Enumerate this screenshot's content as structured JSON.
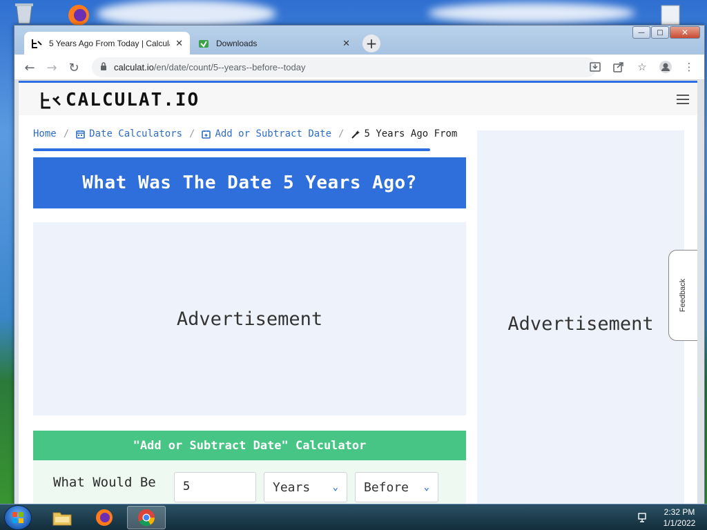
{
  "browser": {
    "tabs": [
      {
        "title": "5 Years Ago From Today | Calcula",
        "active": true
      },
      {
        "title": "Downloads",
        "active": false
      }
    ],
    "new_tab_label": "+",
    "address": {
      "host": "calculat.io",
      "path": "/en/date/count/5--years--before--today"
    }
  },
  "site": {
    "logo_text": "CALCULAT.IO",
    "breadcrumb": [
      {
        "label": "Home",
        "icon": "home"
      },
      {
        "label": "Date Calculators",
        "icon": "calendar-icon"
      },
      {
        "label": "Add or Subtract Date",
        "icon": "calendar-plus-icon"
      },
      {
        "label": "5 Years Ago From",
        "icon": "magic-wand-icon"
      }
    ],
    "breadcrumb_separator": "/",
    "page_title": "What Was The Date 5 Years Ago?",
    "ad_label": "Advertisement",
    "side_ad_label": "Advertisement",
    "calculator": {
      "title": "\"Add or Subtract Date\" Calculator",
      "label": "What Would Be",
      "amount_value": "5",
      "unit_value": "Years",
      "direction_value": "Before"
    },
    "feedback_label": "Feedback"
  },
  "taskbar": {
    "time": "2:32 PM",
    "date": "1/1/2022"
  },
  "colors": {
    "title_band": "#2f6fdc",
    "calc_band": "#46c584",
    "link": "#2e6dc7",
    "ad_bg": "#eef2fb"
  }
}
